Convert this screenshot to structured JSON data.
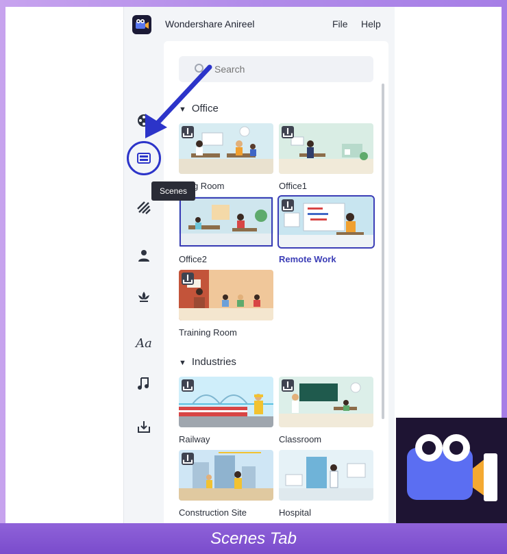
{
  "app": {
    "title": "Wondershare Anireel",
    "logo_icon": "film-camera-logo-icon"
  },
  "menu": {
    "file": "File",
    "help": "Help"
  },
  "rail": {
    "items": [
      {
        "name": "film-reel-icon"
      },
      {
        "name": "scenes-icon",
        "active": true
      },
      {
        "name": "stripes-icon"
      },
      {
        "name": "character-icon"
      },
      {
        "name": "lotus-icon"
      },
      {
        "name": "text-icon",
        "label": "Aa"
      },
      {
        "name": "music-icon"
      },
      {
        "name": "download-icon"
      }
    ],
    "tooltip": "Scenes"
  },
  "search": {
    "placeholder": "Search"
  },
  "sections": [
    {
      "title": "Office",
      "cards": [
        {
          "label": "Meeting Room",
          "visible_label": "eting Room"
        },
        {
          "label": "Office1"
        },
        {
          "label": "Office2"
        },
        {
          "label": "Remote Work",
          "selected": true
        },
        {
          "label": "Training Room"
        }
      ]
    },
    {
      "title": "Industries",
      "cards": [
        {
          "label": "Railway"
        },
        {
          "label": "Classroom"
        },
        {
          "label": "Construction Site"
        },
        {
          "label": "Hospital"
        }
      ]
    }
  ],
  "footer": {
    "caption": "Scenes Tab"
  },
  "colors": {
    "accent": "#3b3db6",
    "annotation": "#2c34c9",
    "footer": "#7a4ccc",
    "brand_bg": "#1e1433"
  }
}
